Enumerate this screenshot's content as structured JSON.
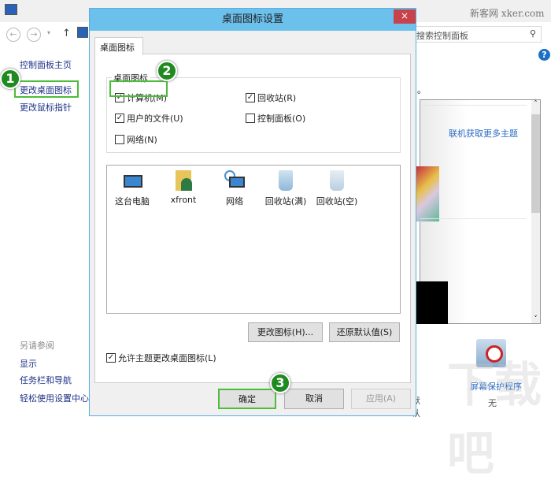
{
  "background_window": {
    "watermark": "新客网 xker.com",
    "search_placeholder": "搜索控制面板",
    "sidebar": {
      "items": [
        {
          "label": "控制面板主页"
        },
        {
          "label": "更改桌面图标"
        },
        {
          "label": "更改鼠标指针"
        }
      ],
      "see_also_title": "另请参阅",
      "see_also": [
        {
          "label": "显示"
        },
        {
          "label": "任务栏和导航"
        },
        {
          "label": "轻松使用设置中心"
        }
      ]
    },
    "get_more_themes": "联机获取更多主题",
    "screensaver_label": "屏幕保护程序",
    "screensaver_value": "无",
    "partial_default": "默认",
    "partial_text": "。"
  },
  "dialog": {
    "title": "桌面图标设置",
    "close_label": "×",
    "tab": "桌面图标",
    "group_title": "桌面图标",
    "checkboxes": [
      {
        "label": "计算机(M)",
        "checked": true
      },
      {
        "label": "回收站(R)",
        "checked": true
      },
      {
        "label": "用户的文件(U)",
        "checked": true
      },
      {
        "label": "控制面板(O)",
        "checked": false
      },
      {
        "label": "网络(N)",
        "checked": false
      }
    ],
    "icons": [
      {
        "label": "这台电脑"
      },
      {
        "label": "xfront"
      },
      {
        "label": "网络"
      },
      {
        "label": "回收站(满)"
      },
      {
        "label": "回收站(空)"
      }
    ],
    "change_icon": "更改图标(H)...",
    "restore_default": "还原默认值(S)",
    "allow_themes": {
      "label": "允许主题更改桌面图标(L)",
      "checked": true
    },
    "ok": "确定",
    "cancel": "取消",
    "apply": "应用(A)"
  },
  "badges": [
    "1",
    "2",
    "3"
  ],
  "colors": {
    "badge": "#1f8a1f",
    "highlight": "#4cbd3a",
    "titlebar": "#6cc0ec",
    "close": "#c7424a",
    "link": "#1e3287"
  }
}
